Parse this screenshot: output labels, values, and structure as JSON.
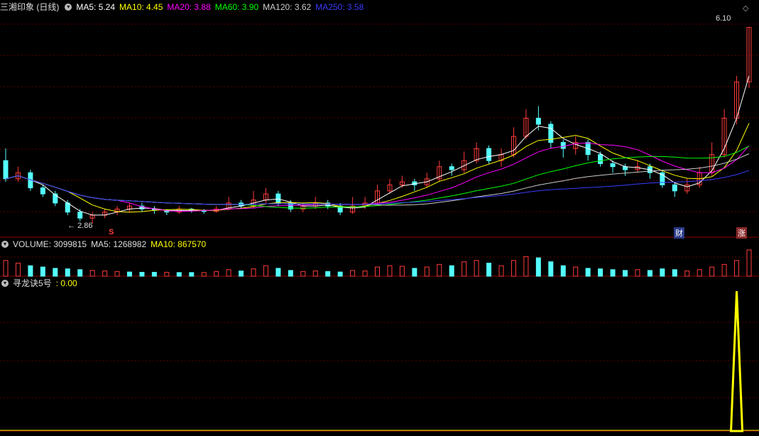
{
  "price_panel": {
    "title": "三湘印象 (日线)",
    "ma_items": [
      {
        "label": "MA5: 5.24",
        "color": "#ffffff"
      },
      {
        "label": "MA10: 4.45",
        "color": "#ffff00"
      },
      {
        "label": "MA20: 3.88",
        "color": "#ff00ff"
      },
      {
        "label": "MA60: 3.90",
        "color": "#00ff00"
      },
      {
        "label": "MA120: 3.62",
        "color": "#cccccc"
      },
      {
        "label": "MA250: 3.58",
        "color": "#3a3aff"
      }
    ],
    "high_label": "6.10",
    "low_label": "2.86",
    "marker_s": "S",
    "marker_cai": "财",
    "marker_zhang": "涨"
  },
  "volume_panel": {
    "title": "VOLUME: 3099815",
    "ma5": "MA5: 1268982",
    "ma10": "MA10: 867570"
  },
  "indicator_panel": {
    "title": "寻龙诀5号",
    "value": ": 0.00"
  },
  "chart_data": {
    "type": "candlestick",
    "up_color": "#ff3b3b",
    "down_color": "#54ffff",
    "y_min": 2.8,
    "y_max": 6.2,
    "candles": [
      [
        3.9,
        3.6,
        4.1,
        3.55
      ],
      [
        3.6,
        3.7,
        3.8,
        3.55
      ],
      [
        3.7,
        3.45,
        3.75,
        3.4
      ],
      [
        3.45,
        3.35,
        3.5,
        3.3
      ],
      [
        3.35,
        3.2,
        3.4,
        3.15
      ],
      [
        3.2,
        3.05,
        3.25,
        3.0
      ],
      [
        3.05,
        2.95,
        3.1,
        2.9
      ],
      [
        2.95,
        3.0,
        3.05,
        2.86
      ],
      [
        3.0,
        3.05,
        3.1,
        2.95
      ],
      [
        3.05,
        3.1,
        3.15,
        3.0
      ],
      [
        3.1,
        3.15,
        3.2,
        3.05
      ],
      [
        3.15,
        3.1,
        3.2,
        3.05
      ],
      [
        3.1,
        3.08,
        3.15,
        3.02
      ],
      [
        3.08,
        3.05,
        3.1,
        3.0
      ],
      [
        3.05,
        3.1,
        3.15,
        3.02
      ],
      [
        3.1,
        3.08,
        3.12,
        3.04
      ],
      [
        3.08,
        3.06,
        3.1,
        3.02
      ],
      [
        3.06,
        3.1,
        3.15,
        3.04
      ],
      [
        3.1,
        3.2,
        3.3,
        3.08
      ],
      [
        3.2,
        3.15,
        3.25,
        3.1
      ],
      [
        3.15,
        3.25,
        3.4,
        3.12
      ],
      [
        3.25,
        3.35,
        3.45,
        3.2
      ],
      [
        3.35,
        3.2,
        3.4,
        3.15
      ],
      [
        3.2,
        3.1,
        3.25,
        3.05
      ],
      [
        3.1,
        3.15,
        3.2,
        3.05
      ],
      [
        3.15,
        3.2,
        3.3,
        3.1
      ],
      [
        3.2,
        3.15,
        3.25,
        3.1
      ],
      [
        3.15,
        3.05,
        3.2,
        3.0
      ],
      [
        3.05,
        3.15,
        3.3,
        3.02
      ],
      [
        3.15,
        3.2,
        3.3,
        3.1
      ],
      [
        3.2,
        3.4,
        3.5,
        3.15
      ],
      [
        3.4,
        3.5,
        3.6,
        3.35
      ],
      [
        3.5,
        3.55,
        3.65,
        3.45
      ],
      [
        3.55,
        3.5,
        3.6,
        3.4
      ],
      [
        3.5,
        3.6,
        3.7,
        3.45
      ],
      [
        3.6,
        3.8,
        3.9,
        3.55
      ],
      [
        3.8,
        3.75,
        3.85,
        3.65
      ],
      [
        3.75,
        3.9,
        4.05,
        3.7
      ],
      [
        3.9,
        4.1,
        4.2,
        3.85
      ],
      [
        4.1,
        3.9,
        4.15,
        3.85
      ],
      [
        3.9,
        4.0,
        4.1,
        3.8
      ],
      [
        4.0,
        4.3,
        4.45,
        3.95
      ],
      [
        4.3,
        4.6,
        4.75,
        4.25
      ],
      [
        4.6,
        4.5,
        4.8,
        4.4
      ],
      [
        4.5,
        4.2,
        4.55,
        4.1
      ],
      [
        4.2,
        4.1,
        4.25,
        3.95
      ],
      [
        4.1,
        4.2,
        4.3,
        4.0
      ],
      [
        4.2,
        4.0,
        4.25,
        3.9
      ],
      [
        4.0,
        3.85,
        4.05,
        3.8
      ],
      [
        3.85,
        3.8,
        3.9,
        3.7
      ],
      [
        3.8,
        3.75,
        3.85,
        3.65
      ],
      [
        3.75,
        3.8,
        3.9,
        3.7
      ],
      [
        3.8,
        3.7,
        3.85,
        3.6
      ],
      [
        3.7,
        3.5,
        3.75,
        3.45
      ],
      [
        3.5,
        3.4,
        3.55,
        3.3
      ],
      [
        3.4,
        3.5,
        3.6,
        3.35
      ],
      [
        3.5,
        3.7,
        3.8,
        3.45
      ],
      [
        3.7,
        4.0,
        4.2,
        3.65
      ],
      [
        4.0,
        4.6,
        4.75,
        3.95
      ],
      [
        4.6,
        5.2,
        5.3,
        4.5
      ],
      [
        5.2,
        6.1,
        6.1,
        5.1
      ]
    ],
    "volume": [
      [
        60,
        1
      ],
      [
        50,
        1
      ],
      [
        40,
        0
      ],
      [
        35,
        0
      ],
      [
        30,
        0
      ],
      [
        28,
        0
      ],
      [
        25,
        0
      ],
      [
        22,
        1
      ],
      [
        20,
        1
      ],
      [
        18,
        1
      ],
      [
        16,
        0
      ],
      [
        15,
        0
      ],
      [
        15,
        0
      ],
      [
        15,
        1
      ],
      [
        14,
        0
      ],
      [
        14,
        0
      ],
      [
        14,
        1
      ],
      [
        18,
        1
      ],
      [
        25,
        1
      ],
      [
        20,
        0
      ],
      [
        28,
        1
      ],
      [
        40,
        1
      ],
      [
        30,
        0
      ],
      [
        22,
        0
      ],
      [
        18,
        1
      ],
      [
        20,
        1
      ],
      [
        18,
        0
      ],
      [
        16,
        0
      ],
      [
        22,
        1
      ],
      [
        20,
        1
      ],
      [
        35,
        1
      ],
      [
        40,
        1
      ],
      [
        38,
        1
      ],
      [
        30,
        0
      ],
      [
        35,
        1
      ],
      [
        45,
        1
      ],
      [
        40,
        0
      ],
      [
        55,
        1
      ],
      [
        60,
        1
      ],
      [
        50,
        0
      ],
      [
        40,
        1
      ],
      [
        60,
        1
      ],
      [
        75,
        1
      ],
      [
        70,
        0
      ],
      [
        55,
        0
      ],
      [
        40,
        0
      ],
      [
        35,
        1
      ],
      [
        30,
        0
      ],
      [
        28,
        0
      ],
      [
        25,
        0
      ],
      [
        22,
        0
      ],
      [
        25,
        1
      ],
      [
        22,
        0
      ],
      [
        28,
        0
      ],
      [
        25,
        0
      ],
      [
        20,
        1
      ],
      [
        25,
        1
      ],
      [
        35,
        1
      ],
      [
        45,
        1
      ],
      [
        60,
        1
      ],
      [
        100,
        1
      ]
    ],
    "indicator": {
      "spike_index": 59,
      "spike_value": 1.0,
      "baseline": 0.0
    }
  }
}
